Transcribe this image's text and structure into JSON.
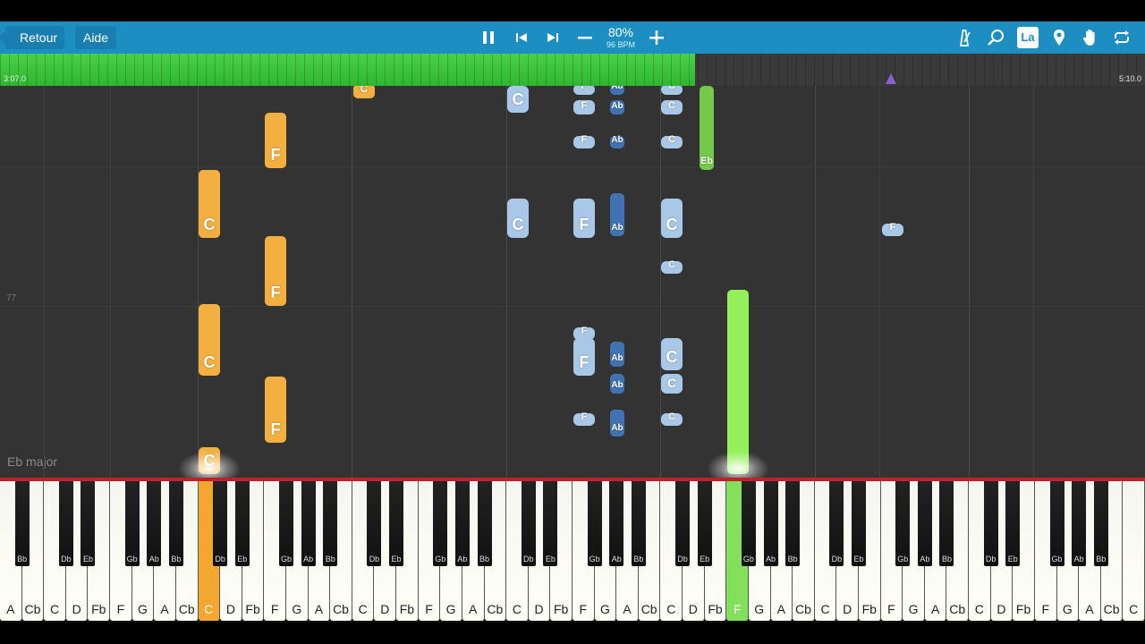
{
  "toolbar": {
    "back_label": "Retour",
    "help_label": "Aide",
    "zoom_value": "80%",
    "tempo_value": "96 BPM",
    "icons": [
      "pause-icon",
      "previous-icon",
      "next-icon",
      "minus-icon",
      "plus-icon",
      "metronome-icon",
      "search-icon",
      "la-icon",
      "location-pin-icon",
      "hand-icon",
      "loop-icon"
    ],
    "la_label": "La"
  },
  "progress": {
    "start_time": "3:07.0",
    "end_time": "5:10.0",
    "played_fraction": 0.607,
    "fill_color": "#33c033"
  },
  "roll": {
    "measure_label": "77",
    "key_label": "Eb major"
  },
  "notes": [
    {
      "name": "C",
      "style": "orange"
    },
    {
      "name": "F",
      "style": "orange"
    },
    {
      "name": "C",
      "style": "orange"
    },
    {
      "name": "F",
      "style": "orange"
    },
    {
      "name": "C",
      "style": "orange"
    },
    {
      "name": "F",
      "style": "orange"
    },
    {
      "name": "C",
      "style": "orange"
    },
    {
      "name": "C",
      "style": "light"
    },
    {
      "name": "F",
      "style": "light"
    },
    {
      "name": "Ab",
      "style": "dark"
    },
    {
      "name": "C",
      "style": "light"
    },
    {
      "name": "F",
      "style": "light"
    },
    {
      "name": "Ab",
      "style": "dark"
    },
    {
      "name": "C",
      "style": "light"
    },
    {
      "name": "F",
      "style": "light"
    },
    {
      "name": "Ab",
      "style": "dark"
    },
    {
      "name": "C",
      "style": "light"
    },
    {
      "name": "C",
      "style": "light"
    },
    {
      "name": "F",
      "style": "light"
    },
    {
      "name": "Ab",
      "style": "dark"
    },
    {
      "name": "C",
      "style": "light"
    },
    {
      "name": "C",
      "style": "light"
    },
    {
      "name": "F",
      "style": "light"
    },
    {
      "name": "Ab",
      "style": "dark"
    },
    {
      "name": "C",
      "style": "light"
    },
    {
      "name": "F",
      "style": "light"
    },
    {
      "name": "Ab",
      "style": "dark"
    },
    {
      "name": "Ab",
      "style": "dark"
    },
    {
      "name": "C",
      "style": "light"
    },
    {
      "name": "F",
      "style": "light"
    },
    {
      "name": "Ab",
      "style": "dark"
    },
    {
      "name": "C",
      "style": "light"
    },
    {
      "name": "Eb",
      "style": "green"
    },
    {
      "name": "F",
      "style": "light"
    },
    {
      "name": "F",
      "style": "light"
    },
    {
      "name": "",
      "style": "bright"
    }
  ],
  "keyboard": {
    "white_keys": [
      "A",
      "Cb",
      "C",
      "D",
      "Fb",
      "F",
      "G",
      "A",
      "Cb",
      "C",
      "D",
      "Fb",
      "F",
      "G",
      "A",
      "Cb",
      "C",
      "D",
      "Fb",
      "F",
      "G",
      "A",
      "Cb",
      "C",
      "D",
      "Fb",
      "F",
      "G",
      "A",
      "Cb",
      "C",
      "D",
      "Fb",
      "F",
      "G",
      "A",
      "Cb",
      "C",
      "D",
      "Fb",
      "F",
      "G",
      "A",
      "Cb",
      "C",
      "D",
      "Fb",
      "F",
      "G",
      "A",
      "Cb",
      "C"
    ],
    "pressed": [
      {
        "index": 9,
        "color": "orange"
      },
      {
        "index": 33,
        "color": "green"
      }
    ],
    "black_keys": [
      "Bb",
      "Db",
      "Eb",
      "Gb",
      "Ab",
      "Bb",
      "Db",
      "Eb",
      "Gb",
      "Ab",
      "Bb",
      "Db",
      "Eb",
      "Gb",
      "Ab",
      "Bb",
      "Db",
      "Eb",
      "Gb",
      "Ab",
      "Bb",
      "Db",
      "Eb",
      "Gb",
      "Ab",
      "Bb",
      "Db",
      "Eb",
      "Gb",
      "Ab",
      "Bb",
      "Db",
      "Eb",
      "Gb",
      "Ab",
      "Bb"
    ]
  }
}
